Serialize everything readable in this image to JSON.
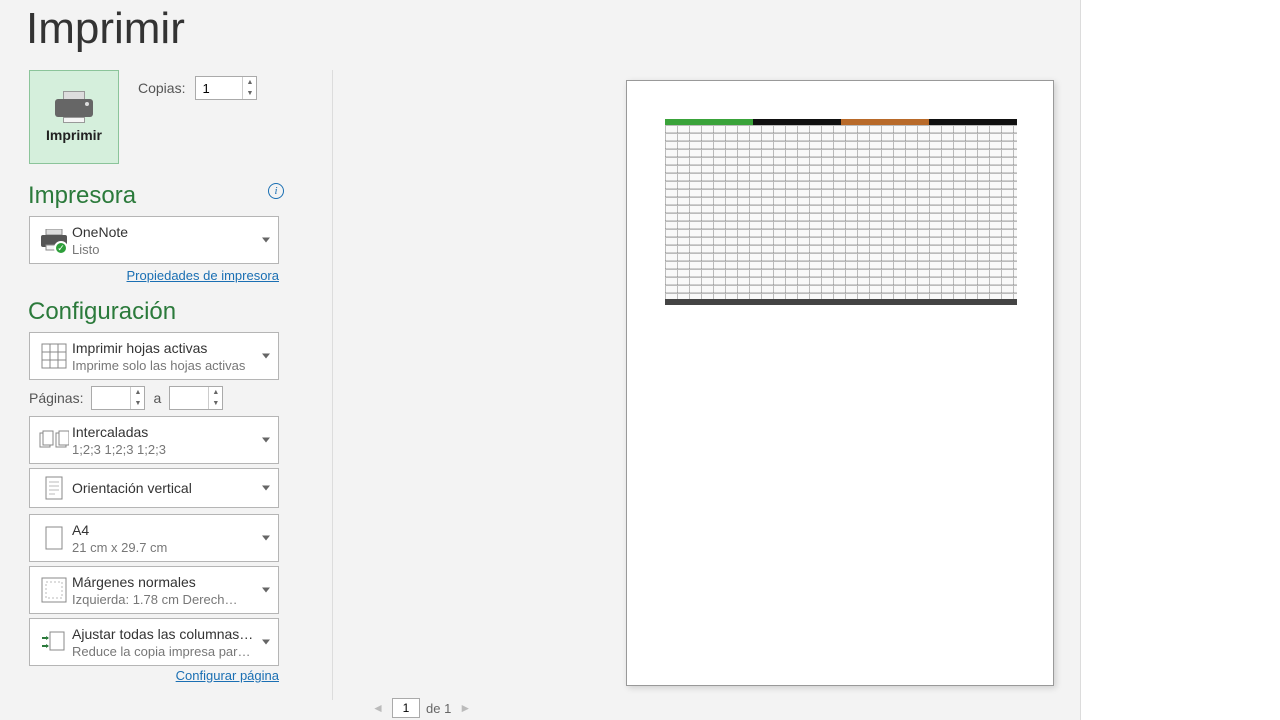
{
  "title": "Imprimir",
  "print_button_label": "Imprimir",
  "copies_label": "Copias:",
  "copies_value": "1",
  "sections": {
    "printer": "Impresora",
    "config": "Configuración"
  },
  "printer": {
    "name": "OneNote",
    "status": "Listo",
    "properties_link": "Propiedades de impresora"
  },
  "config": {
    "print_what": {
      "title": "Imprimir hojas activas",
      "sub": "Imprime solo las hojas activas"
    },
    "pages_label": "Páginas:",
    "pages_from": "",
    "pages_sep": "a",
    "pages_to": "",
    "collate": {
      "title": "Intercaladas",
      "sub": "1;2;3    1;2;3    1;2;3"
    },
    "orientation": {
      "title": "Orientación vertical"
    },
    "paper": {
      "title": "A4",
      "sub": "21 cm x 29.7 cm"
    },
    "margins": {
      "title": "Márgenes normales",
      "sub": "Izquierda:  1.78 cm    Derech…"
    },
    "scaling": {
      "title": "Ajustar todas las columnas…",
      "sub": "Reduce la copia impresa par…"
    },
    "page_setup_link": "Configurar página"
  },
  "page_nav": {
    "current": "1",
    "of_label": "de 1"
  },
  "preview_header_colors": [
    "#3aa33a",
    "#3aa33a",
    "#111",
    "#111",
    "#b86a2a",
    "#b86a2a",
    "#111",
    "#111"
  ]
}
